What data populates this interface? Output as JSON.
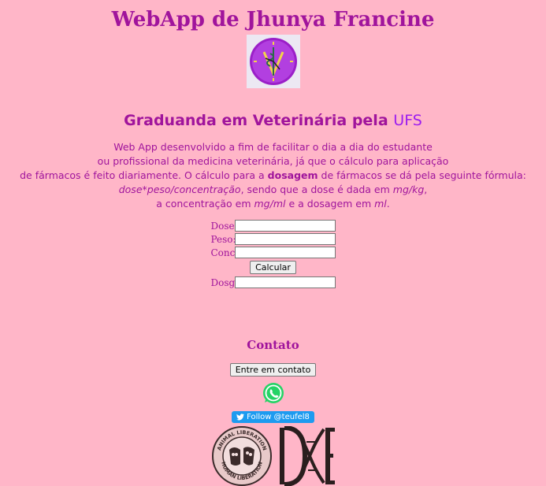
{
  "header": {
    "title": "WebApp de Jhunya Francine"
  },
  "subtitle": {
    "text": "Graduanda em Veterinária pela",
    "highlight": "UFS"
  },
  "description": {
    "line1": "Web App desenvolvido a fim de facilitar o dia a dia do estudante",
    "line2": "ou profissional da medicina veterinária, já que o cálculo para aplicação",
    "line3a": "de fármacos é feito diariamente. O cálculo para a ",
    "line3b": "dosagem",
    "line3c": " de fármacos se dá pela seguinte fórmula:",
    "line4a": "dose*peso/concentração",
    "line4b": ", sendo que a dose é dada em ",
    "line4c": "mg/kg",
    "line4d": ",",
    "line5a": "a concentração em ",
    "line5b": "mg/ml",
    "line5c": " e a dosagem em ",
    "line5d": "ml",
    "line5e": "."
  },
  "form": {
    "dose_label": "Dose:",
    "peso_label": "Peso:",
    "conc_label": "Conc:",
    "calc_label": "Calcular",
    "dosg_label": "Dosg:",
    "dose_value": "",
    "peso_value": "",
    "conc_value": "",
    "dosg_value": ""
  },
  "contact": {
    "title": "Contato",
    "button_label": "Entre em contato",
    "twitter_label": "Follow @teufel8"
  },
  "badges": {
    "animal_lib_top": "ANIMAL LIBERATION",
    "animal_lib_bottom": "HUMAN LIBERATION"
  },
  "colors": {
    "background": "#ffb6c8",
    "text": "#a0149c",
    "ufs": "#9c1cf0",
    "twitter": "#1d9bf0",
    "whatsapp": "#25d366"
  }
}
